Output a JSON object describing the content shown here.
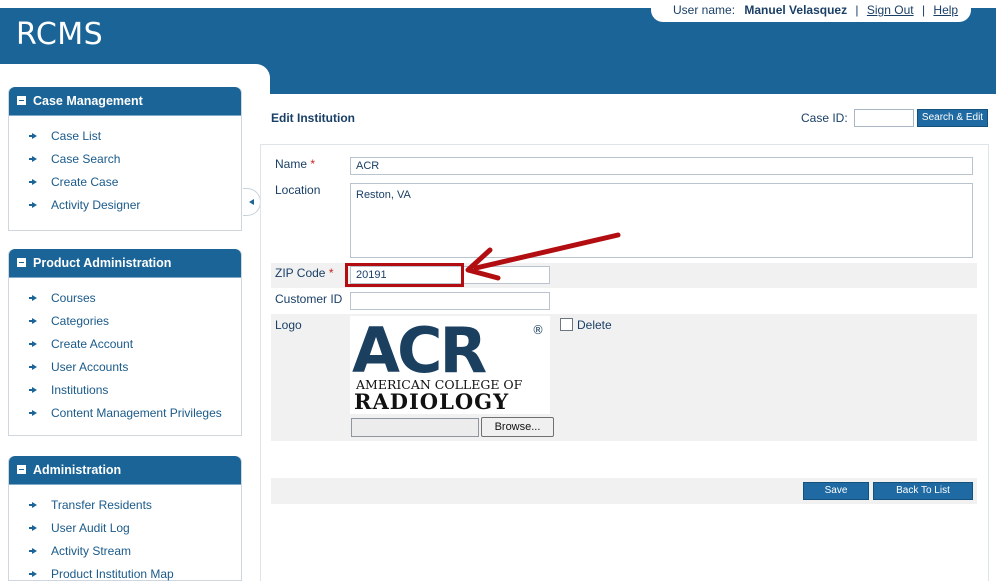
{
  "app": {
    "title": "RCMS"
  },
  "userbar": {
    "label": "User name:",
    "username": "Manuel Velasquez",
    "sign_out": "Sign Out",
    "help": "Help",
    "separator": "|"
  },
  "sidebar": {
    "panels": [
      {
        "title": "Case Management",
        "items": [
          "Case List",
          "Case Search",
          "Create Case",
          "Activity Designer"
        ]
      },
      {
        "title": "Product Administration",
        "items": [
          "Courses",
          "Categories",
          "Create Account",
          "User Accounts",
          "Institutions",
          "Content Management Privileges"
        ]
      },
      {
        "title": "Administration",
        "items": [
          "Transfer Residents",
          "User Audit Log",
          "Activity Stream",
          "Product Institution Map"
        ]
      }
    ]
  },
  "main": {
    "title": "Edit Institution",
    "case_id_label": "Case ID:",
    "case_id_value": "",
    "search_button": "Search & Edit"
  },
  "form": {
    "name": {
      "label": "Name",
      "required": "*",
      "value": "ACR"
    },
    "location": {
      "label": "Location",
      "value": "Reston, VA"
    },
    "zip": {
      "label": "ZIP Code",
      "required": "*",
      "value": "20191"
    },
    "customer_id": {
      "label": "Customer ID",
      "value": ""
    },
    "logo": {
      "label": "Logo",
      "delete_label": "Delete",
      "delete_checked": false,
      "browse_label": "Browse...",
      "image_text_big": "ACR",
      "image_text_reg": "®",
      "image_text_line1": "American College of",
      "image_text_line2": "Radiology"
    }
  },
  "actions": {
    "save": "Save",
    "back": "Back To List"
  },
  "colors": {
    "brand": "#1a6497",
    "annotation": "#b20e12",
    "logo_navy": "#1b3f5e"
  },
  "icons": [
    "collapse-icon",
    "bullet-arrow-icon",
    "sidebar-collapse-icon",
    "annotation-arrow-icon"
  ]
}
